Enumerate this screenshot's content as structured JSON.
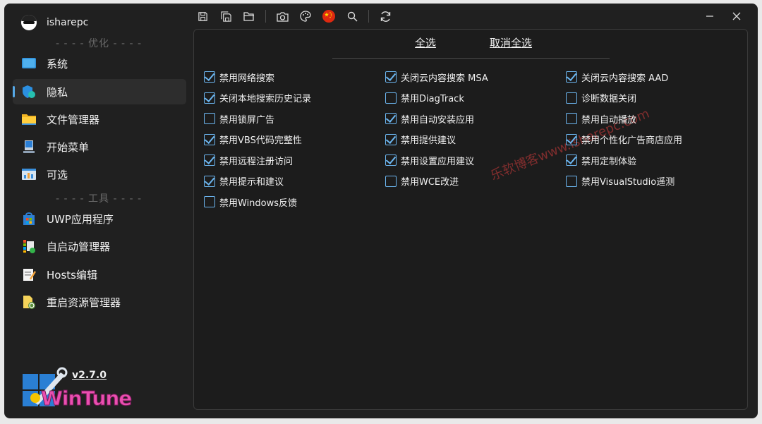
{
  "app": {
    "name": "isharepc",
    "version": "v2.7.0",
    "logo_text": "WinTune"
  },
  "sidebar": {
    "section_optimize": "- - - - 优化 - - - -",
    "section_tools": "- - - - 工具 - - - -",
    "items": [
      {
        "label": "系统",
        "icon": "monitor-icon"
      },
      {
        "label": "隐私",
        "icon": "shield-icon",
        "active": true
      },
      {
        "label": "文件管理器",
        "icon": "folder-icon"
      },
      {
        "label": "开始菜单",
        "icon": "computer-icon"
      },
      {
        "label": "可选",
        "icon": "window-chart-icon"
      },
      {
        "label": "UWP应用程序",
        "icon": "store-icon"
      },
      {
        "label": "自启动管理器",
        "icon": "startup-icon"
      },
      {
        "label": "Hosts编辑",
        "icon": "edit-note-icon"
      },
      {
        "label": "重启资源管理器",
        "icon": "restart-explorer-icon"
      }
    ]
  },
  "toolbar": {
    "buttons": [
      "save-icon",
      "save-as-icon",
      "open-folder-icon",
      "camera-icon",
      "palette-icon",
      "language-flag-icon",
      "search-icon",
      "refresh-icon"
    ]
  },
  "main": {
    "select_all": "全选",
    "deselect_all": "取消全选",
    "watermark": "乐软博客www.isharepc.com",
    "options": [
      {
        "label": "禁用网络搜索",
        "checked": true
      },
      {
        "label": "关闭云内容搜索 MSA",
        "checked": true
      },
      {
        "label": "关闭云内容搜索 AAD",
        "checked": true
      },
      {
        "label": "关闭本地搜索历史记录",
        "checked": true
      },
      {
        "label": "禁用DiagTrack",
        "checked": false
      },
      {
        "label": "诊断数据关闭",
        "checked": false
      },
      {
        "label": "禁用锁屏广告",
        "checked": false
      },
      {
        "label": "禁用自动安装应用",
        "checked": true
      },
      {
        "label": "禁用自动播放",
        "checked": false
      },
      {
        "label": "禁用VBS代码完整性",
        "checked": true
      },
      {
        "label": "禁用提供建议",
        "checked": true
      },
      {
        "label": "禁用个性化广告商店应用",
        "checked": true
      },
      {
        "label": "禁用远程注册访问",
        "checked": true
      },
      {
        "label": "禁用设置应用建议",
        "checked": true
      },
      {
        "label": "禁用定制体验",
        "checked": true
      },
      {
        "label": "禁用提示和建议",
        "checked": true
      },
      {
        "label": "禁用WCE改进",
        "checked": false
      },
      {
        "label": "禁用VisualStudio遥测",
        "checked": false
      },
      {
        "label": "禁用Windows反馈",
        "checked": false
      }
    ]
  },
  "colors": {
    "accent": "#6cb6f0",
    "window_bg": "#202020",
    "panel_bg": "#1c1c1c"
  }
}
